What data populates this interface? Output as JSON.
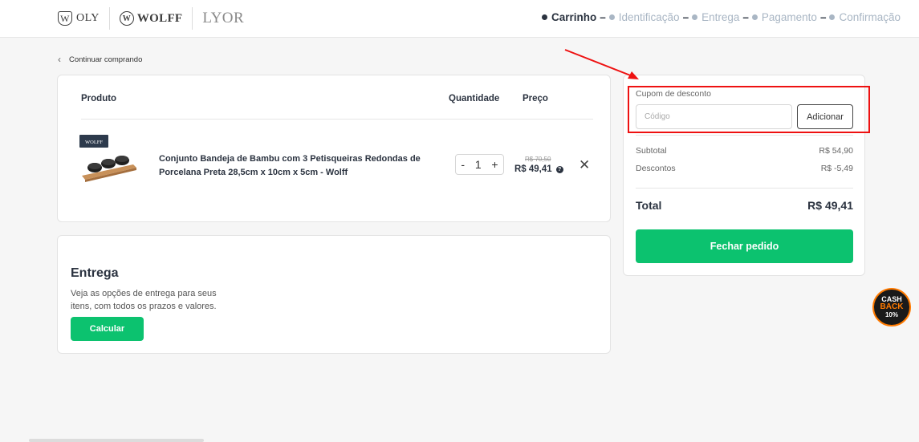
{
  "header": {
    "logos": {
      "woly": "OLY",
      "woly_mark": "W",
      "wolff": "WOLFF",
      "wolff_mark": "W",
      "lyor": "LYOR"
    },
    "steps": [
      {
        "label": "Carrinho",
        "active": true
      },
      {
        "label": "Identificação",
        "active": false
      },
      {
        "label": "Entrega",
        "active": false
      },
      {
        "label": "Pagamento",
        "active": false
      },
      {
        "label": "Confirmação",
        "active": false
      }
    ],
    "step_separator": "–"
  },
  "back_link": {
    "label": "Continuar comprando",
    "icon": "chevron-left-icon"
  },
  "cart": {
    "columns": {
      "product": "Produto",
      "quantity": "Quantidade",
      "price": "Preço"
    },
    "items": [
      {
        "name": "Conjunto Bandeja de Bambu com 3 Petisqueiras Redondas de Porcelana Preta 28,5cm x 10cm x 5cm - Wolff",
        "brand_tag": "WOLFF",
        "quantity": "1",
        "minus": "-",
        "plus": "+",
        "old_price": "R$ 70,50",
        "price": "R$ 49,41",
        "help": "?",
        "remove": "✕"
      }
    ]
  },
  "delivery": {
    "title": "Entrega",
    "description": "Veja as opções de entrega para seus itens, com todos os prazos e valores.",
    "button": "Calcular"
  },
  "summary": {
    "coupon_label": "Cupom de desconto",
    "coupon_placeholder": "Código",
    "coupon_button": "Adicionar",
    "subtotal_label": "Subtotal",
    "subtotal_value": "R$ 54,90",
    "discount_label": "Descontos",
    "discount_value": "R$ -5,49",
    "total_label": "Total",
    "total_value": "R$ 49,41",
    "checkout_button": "Fechar pedido"
  },
  "cashback": {
    "line1": "CASH",
    "line2": "BACK",
    "line3": "10%"
  },
  "colors": {
    "accent": "#0cc26f",
    "highlight": "#e11111",
    "dark": "#2b3340"
  }
}
